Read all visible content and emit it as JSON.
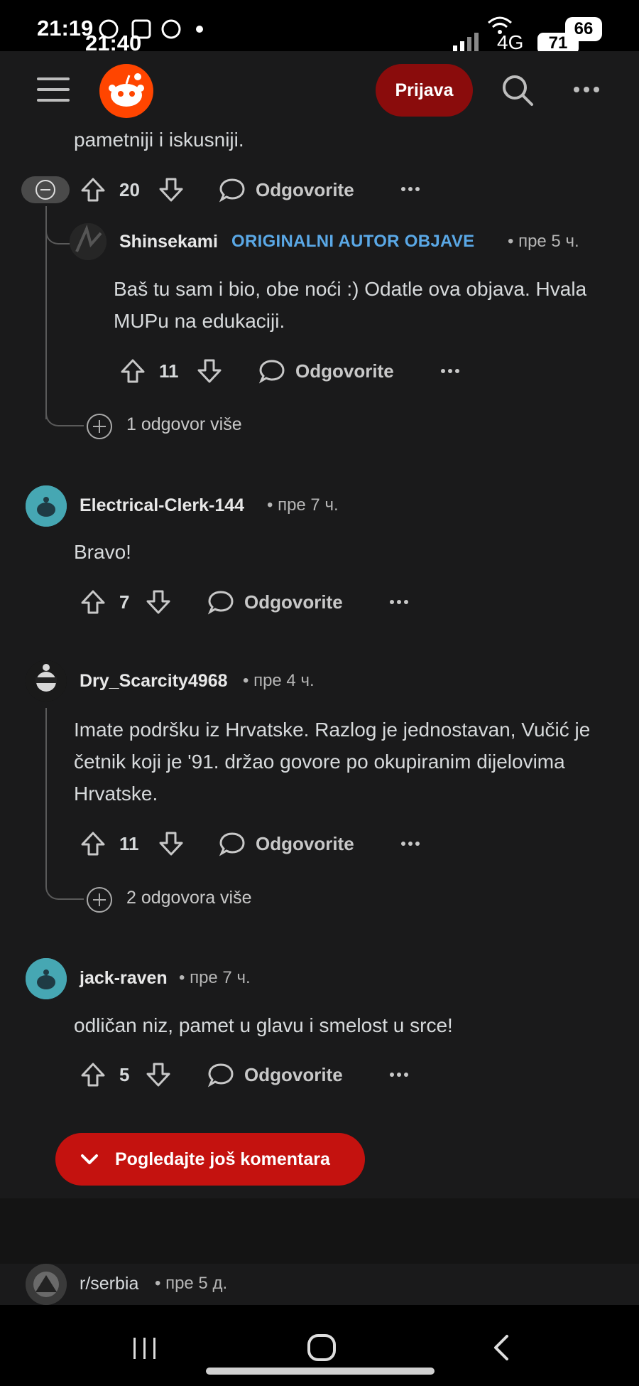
{
  "status_bar": {
    "time_overlay_1": "21:19",
    "time_overlay_2": "21:40",
    "network": "4G",
    "battery_1": "71",
    "battery_2": "66"
  },
  "header": {
    "login_label": "Prijava"
  },
  "top_comment_tail": {
    "text": "pametniji i iskusniji.",
    "votes": "20",
    "reply_label": "Odgovorite"
  },
  "comments": [
    {
      "username": "Shinsekami",
      "badge": "ORIGINALNI AUTOR OBJAVE",
      "meta": "• пре 5 ч.",
      "text": "Baš tu sam i bio, obe noći :) Odatle ova objava. Hvala MUPu na edukaciji.",
      "votes": "11",
      "reply_label": "Odgovorite"
    },
    {
      "username": "Electrical-Clerk-144",
      "meta": "• пре 7 ч.",
      "text": "Bravo!",
      "votes": "7",
      "reply_label": "Odgovorite"
    },
    {
      "username": "Dry_Scarcity4968",
      "meta": "• пре 4 ч.",
      "text": "Imate podršku iz Hrvatske. Razlog je jednostavan, Vučić je četnik koji je '91. držao govore po okupiranim dijelovima Hrvatske.",
      "votes": "11",
      "reply_label": "Odgovorite"
    },
    {
      "username": "jack-raven",
      "meta": "• пре 7 ч.",
      "text": "odličan niz, pamet u glavu i smelost u srce!",
      "votes": "5",
      "reply_label": "Odgovorite"
    }
  ],
  "more_replies": [
    "1 odgovor više",
    "2 odgovora više"
  ],
  "view_more_label": "Pogledajte još komentara",
  "next_post": {
    "subreddit": "r/serbia",
    "meta": "• пре 5 д."
  },
  "colors": {
    "background": "#1a1a1b",
    "brand_orange": "#ff4500",
    "op_badge_blue": "#5aa8e6",
    "login_red": "#8a0c0c",
    "view_more_red": "#c4120f"
  }
}
